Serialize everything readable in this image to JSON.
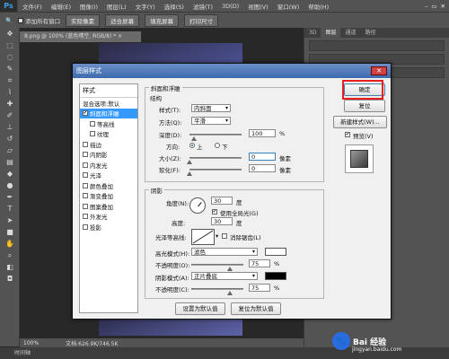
{
  "app": {
    "logo": "Ps",
    "menu": [
      "文件(F)",
      "编辑(E)",
      "图像(I)",
      "图层(L)",
      "文字(Y)",
      "选择(S)",
      "滤镜(T)",
      "3D(D)",
      "视图(V)",
      "窗口(W)",
      "帮助(H)"
    ]
  },
  "optionsbar": {
    "add_all_windows": "添加所有窗口",
    "actual_pixels": "实际像素",
    "fit_screen": "适合屏幕",
    "fill_screen": "填充屏幕",
    "print_size": "打印尺寸"
  },
  "document": {
    "tab": "8.png @ 100% (蓝色晴空, RGB/8) * ×",
    "zoom": "100%",
    "doc_size": "文档:626.9K/746.5K"
  },
  "bottom_tab": "时间轴",
  "right_panel": {
    "tabs": [
      "3D",
      "图层",
      "通道",
      "路径"
    ]
  },
  "dialog": {
    "title": "图层样式",
    "styles_header": "样式",
    "blend_options": "混合选项:默认",
    "styles": [
      {
        "label": "斜面和浮雕",
        "checked": true,
        "selected": true,
        "sub": false
      },
      {
        "label": "等高线",
        "checked": false,
        "selected": false,
        "sub": true
      },
      {
        "label": "纹理",
        "checked": false,
        "selected": false,
        "sub": true
      },
      {
        "label": "描边",
        "checked": false,
        "selected": false,
        "sub": false
      },
      {
        "label": "内阴影",
        "checked": false,
        "selected": false,
        "sub": false
      },
      {
        "label": "内发光",
        "checked": false,
        "selected": false,
        "sub": false
      },
      {
        "label": "光泽",
        "checked": false,
        "selected": false,
        "sub": false
      },
      {
        "label": "颜色叠加",
        "checked": false,
        "selected": false,
        "sub": false
      },
      {
        "label": "渐变叠加",
        "checked": false,
        "selected": false,
        "sub": false
      },
      {
        "label": "图案叠加",
        "checked": false,
        "selected": false,
        "sub": false
      },
      {
        "label": "外发光",
        "checked": false,
        "selected": false,
        "sub": false
      },
      {
        "label": "投影",
        "checked": false,
        "selected": false,
        "sub": false
      }
    ],
    "bevel": {
      "group_title": "斜面和浮雕",
      "structure_title": "结构",
      "style_label": "样式(T):",
      "style_value": "内斜面",
      "technique_label": "方法(Q):",
      "technique_value": "平滑",
      "depth_label": "深度(D):",
      "depth_value": "100",
      "depth_level": 0.1,
      "depth_unit": "%",
      "direction_label": "方向:",
      "direction_up": "上",
      "direction_down": "下",
      "size_label": "大小(Z):",
      "size_value": "0",
      "size_unit": "像素",
      "soften_label": "软化(F):",
      "soften_value": "0",
      "soften_unit": "像素"
    },
    "shading": {
      "title": "阴影",
      "angle_label": "角度(N):",
      "angle_value": "30",
      "angle_unit": "度",
      "global_light": "使用全局光(G)",
      "altitude_label": "高度:",
      "altitude_value": "30",
      "altitude_unit": "度",
      "gloss_label": "光泽等高线:",
      "antialias": "消除锯齿(L)",
      "highlight_mode_label": "高光模式(H):",
      "highlight_mode": "滤色",
      "highlight_opacity_label": "不透明度(O):",
      "highlight_opacity": "75",
      "shadow_mode_label": "阴影模式(A):",
      "shadow_mode": "正片叠底",
      "shadow_opacity_label": "不透明度(C):",
      "shadow_opacity": "75",
      "pct": "%",
      "highlight_color": "#ffffff",
      "shadow_color": "#000000"
    },
    "buttons": {
      "ok": "确定",
      "reset": "复位",
      "new_style": "新建样式(W)...",
      "preview": "预览(V)",
      "make_default": "设置为默认值",
      "reset_default": "复位为默认值"
    }
  },
  "watermark": {
    "brand": "Bai 经验",
    "url": "jingyan.baidu.com"
  }
}
